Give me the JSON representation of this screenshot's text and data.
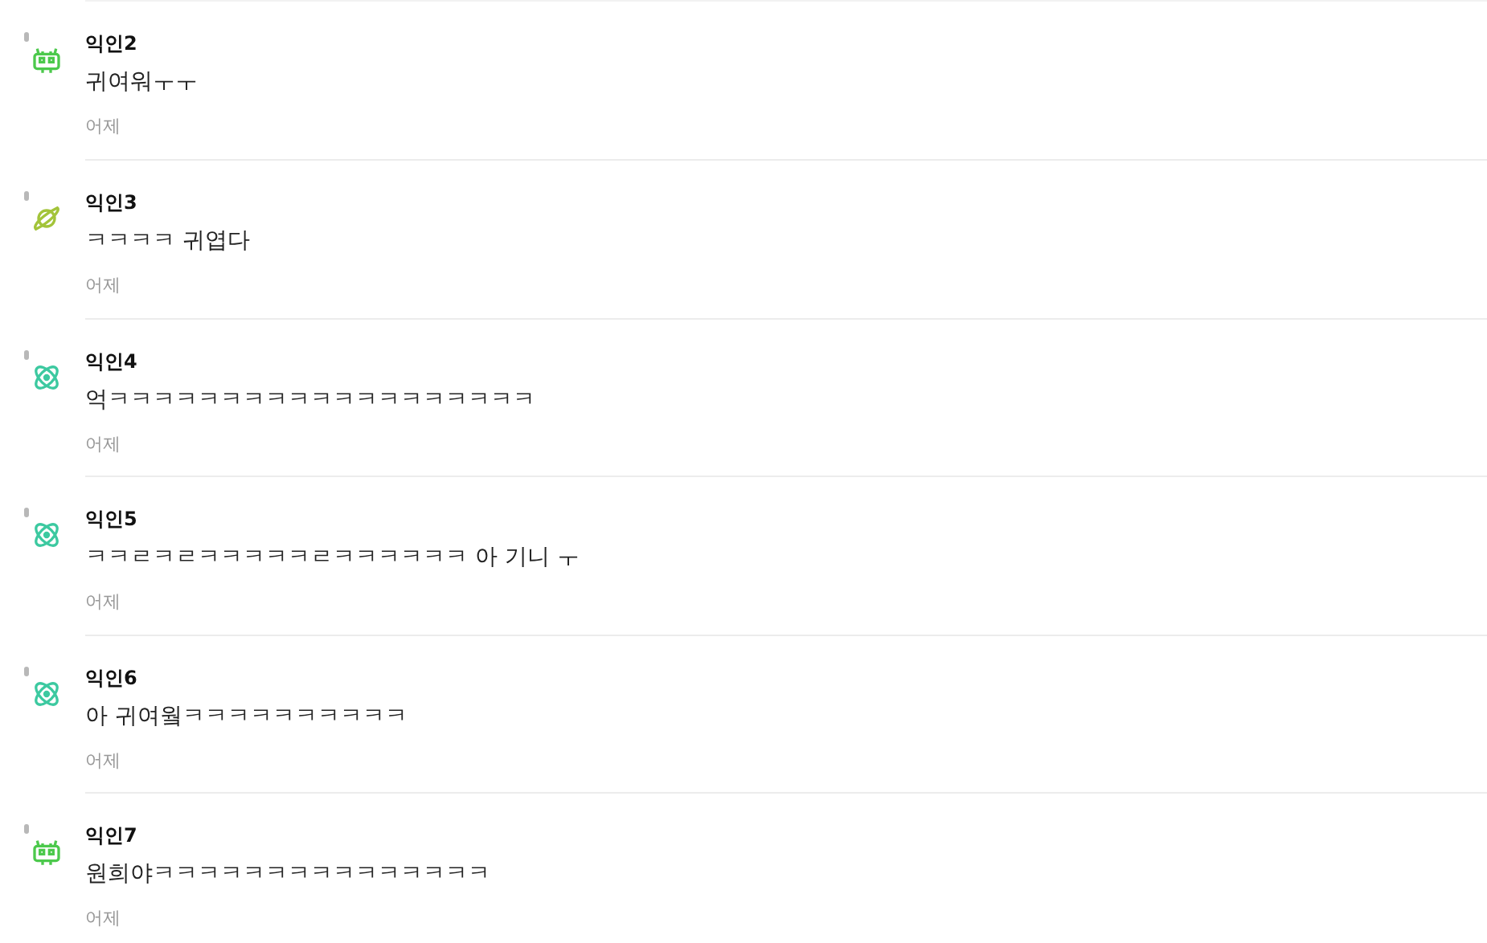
{
  "comments": [
    {
      "author": "익인2",
      "text": "귀여워ㅜㅜ",
      "time": "어제",
      "avatar": {
        "kind": "robot",
        "color": "#4cc94c"
      }
    },
    {
      "author": "익인3",
      "text": "ㅋㅋㅋㅋ 귀엽다",
      "time": "어제",
      "avatar": {
        "kind": "planet",
        "color": "#a3c43a"
      }
    },
    {
      "author": "익인4",
      "text": "억ㅋㅋㅋㅋㅋㅋㅋㅋㅋㅋㅋㅋㅋㅋㅋㅋㅋㅋㅋ",
      "time": "어제",
      "avatar": {
        "kind": "atom",
        "color": "#3cc9a0"
      }
    },
    {
      "author": "익인5",
      "text": "ㅋㅋㄹㅋㄹㅋㅋㅋㅋㅋㄹㅋㅋㅋㅋㅋㅋ 아 기니 ㅜ",
      "time": "어제",
      "avatar": {
        "kind": "atom",
        "color": "#3cc9a0"
      }
    },
    {
      "author": "익인6",
      "text": "아 귀여웤ㅋㅋㅋㅋㅋㅋㅋㅋㅋㅋ",
      "time": "어제",
      "avatar": {
        "kind": "atom",
        "color": "#3cc9a0"
      }
    },
    {
      "author": "익인7",
      "text": "원희야ㅋㅋㅋㅋㅋㅋㅋㅋㅋㅋㅋㅋㅋㅋㅋ",
      "time": "어제",
      "avatar": {
        "kind": "robot",
        "color": "#4cc94c"
      }
    }
  ]
}
